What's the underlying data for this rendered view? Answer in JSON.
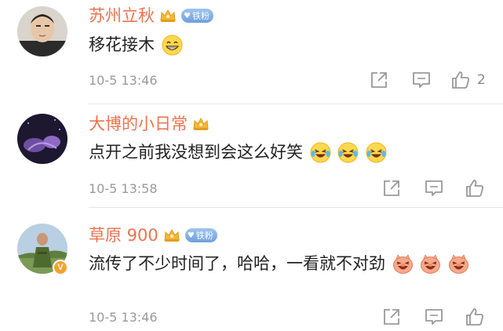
{
  "comments": [
    {
      "username": "苏州立秋",
      "fan_badge": "铁粉",
      "text": "移花接木",
      "emojis": [
        "grin-emoji"
      ],
      "time": "10-5 13:46",
      "likes": "2"
    },
    {
      "username": "大博的小日常",
      "text": "点开之前我没想到会这么好笑",
      "emojis": [
        "laugh-cry-emoji",
        "laugh-cry-emoji",
        "laugh-cry-emoji"
      ],
      "time": "10-5 13:58"
    },
    {
      "username": "草原 900",
      "fan_badge": "铁粉",
      "verified_badge": "V",
      "text": "流传了不少时间了，哈哈，一看就不对劲",
      "emojis": [
        "pig-laugh-emoji",
        "pig-laugh-emoji",
        "pig-laugh-emoji"
      ],
      "time": "10-5 13:46"
    }
  ],
  "icons": [
    "share-icon",
    "comment-icon",
    "like-icon",
    "crown-icon"
  ],
  "colors": {
    "username": "#eb7350",
    "text": "#222222",
    "time": "#9a9a9a",
    "fan_badge": "#7aa7e0",
    "verified": "#f7a128"
  }
}
